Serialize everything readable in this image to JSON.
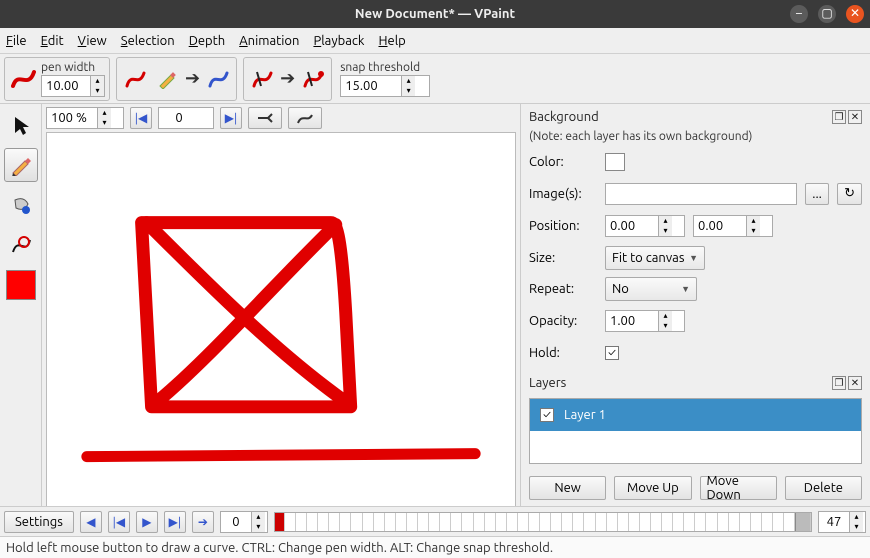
{
  "window": {
    "title": "New Document* — VPaint"
  },
  "menu": {
    "file": "File",
    "edit": "Edit",
    "view": "View",
    "selection": "Selection",
    "depth": "Depth",
    "animation": "Animation",
    "playback": "Playback",
    "help": "Help"
  },
  "toolbar": {
    "pen_width_label": "pen width",
    "pen_width_value": "10.00",
    "snap_label": "snap threshold",
    "snap_value": "15.00"
  },
  "canvasbar": {
    "zoom": "100 %",
    "frame": "0"
  },
  "background": {
    "title": "Background",
    "note": "(Note: each layer has its own background)",
    "labels": {
      "color": "Color:",
      "images": "Image(s):",
      "position": "Position:",
      "size": "Size:",
      "repeat": "Repeat:",
      "opacity": "Opacity:",
      "hold": "Hold:"
    },
    "images_value": "",
    "pos_x": "0.00",
    "pos_y": "0.00",
    "size_value": "Fit to canvas",
    "repeat_value": "No",
    "opacity_value": "1.00",
    "hold_checked": "✓",
    "browse": "...",
    "reload": "↻"
  },
  "layers": {
    "title": "Layers",
    "items": [
      {
        "name": "Layer 1",
        "visible": "✓"
      }
    ],
    "buttons": {
      "new": "New",
      "up": "Move Up",
      "down": "Move Down",
      "del": "Delete"
    }
  },
  "bottom": {
    "settings": "Settings",
    "frame_value": "0",
    "end_frame": "47"
  },
  "status": "Hold left mouse button to draw a curve. CTRL: Change pen width. ALT: Change snap threshold.",
  "colors": {
    "current": "#ff0000"
  }
}
